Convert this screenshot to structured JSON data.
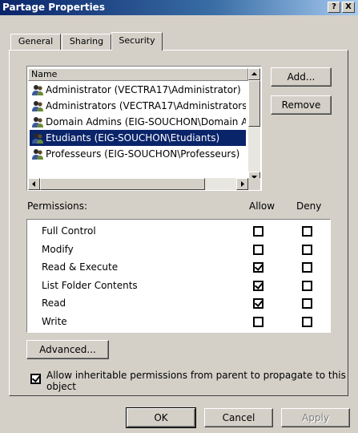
{
  "window": {
    "title": "Partage Properties",
    "help_glyph": "?",
    "close_glyph": "X"
  },
  "tabs": [
    {
      "label": "General"
    },
    {
      "label": "Sharing"
    },
    {
      "label": "Security"
    }
  ],
  "principals": {
    "header": "Name",
    "items": [
      {
        "label": "Administrator (VECTRA17\\Administrator)",
        "selected": false
      },
      {
        "label": "Administrators (VECTRA17\\Administrators)",
        "selected": false
      },
      {
        "label": "Domain Admins (EIG-SOUCHON\\Domain Admins)",
        "selected": false
      },
      {
        "label": "Etudiants (EIG-SOUCHON\\Etudiants)",
        "selected": true
      },
      {
        "label": "Professeurs (EIG-SOUCHON\\Professeurs)",
        "selected": false
      }
    ],
    "add_label": "Add...",
    "remove_label": "Remove"
  },
  "permissions": {
    "label": "Permissions:",
    "allow_header": "Allow",
    "deny_header": "Deny",
    "rows": [
      {
        "name": "Full Control",
        "allow": false,
        "deny": false
      },
      {
        "name": "Modify",
        "allow": false,
        "deny": false
      },
      {
        "name": "Read & Execute",
        "allow": true,
        "deny": false
      },
      {
        "name": "List Folder Contents",
        "allow": true,
        "deny": false
      },
      {
        "name": "Read",
        "allow": true,
        "deny": false
      },
      {
        "name": "Write",
        "allow": false,
        "deny": false
      }
    ]
  },
  "advanced_label": "Advanced...",
  "inherit": {
    "checked": true,
    "line1": "Allow inheritable permissions from parent to propagate to this",
    "line2": "object"
  },
  "footer": {
    "ok": "OK",
    "cancel": "Cancel",
    "apply": "Apply"
  }
}
